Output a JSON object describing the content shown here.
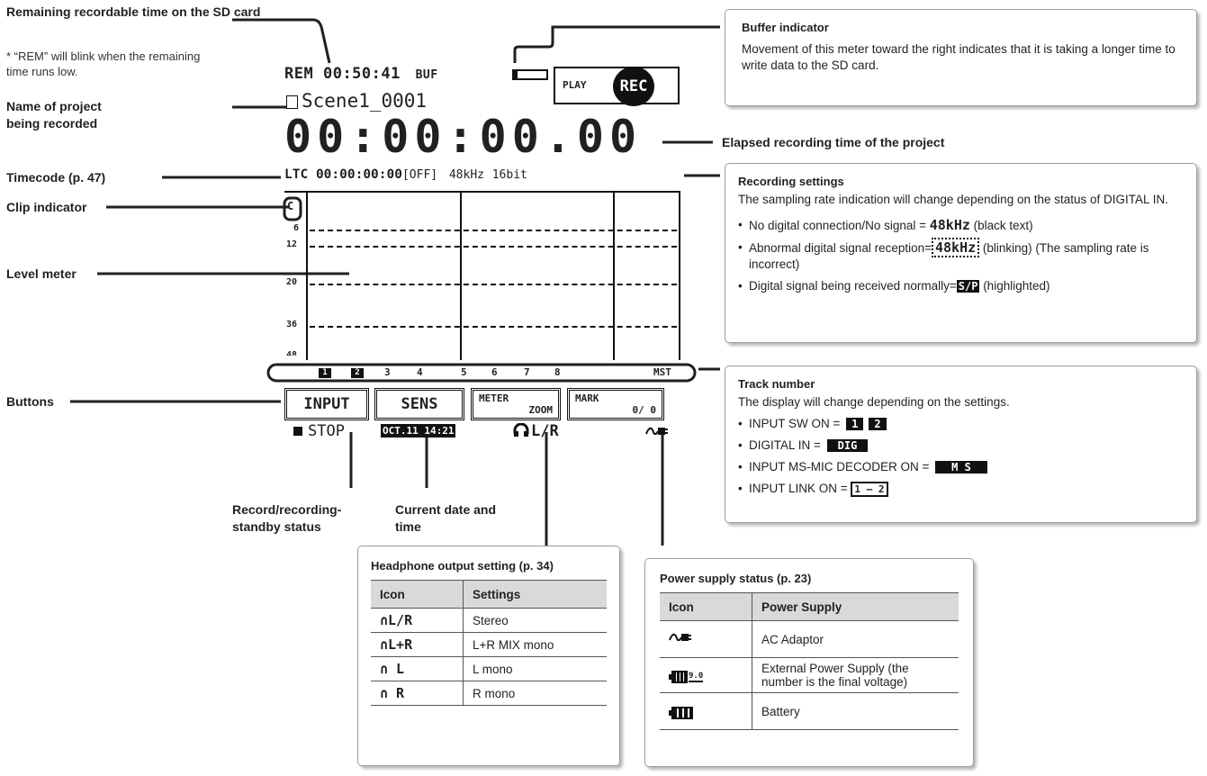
{
  "left_labels": {
    "remaining": "Remaining recordable time on the SD card",
    "remaining_note": "* “REM” will blink when the remaining time runs low.",
    "project_name": "Name of project being recorded",
    "timecode": "Timecode (p. 47)",
    "clip": "Clip indicator",
    "level_meter": "Level meter",
    "buttons": "Buttons"
  },
  "bottom_labels": {
    "record_status": "Record/recording-standby status",
    "date_time": "Current date and time"
  },
  "elapsed_label": "Elapsed recording time of the project",
  "screen": {
    "rem": "REM",
    "rem_time": "00:50:41",
    "buf": "BUF",
    "play": "PLAY",
    "rec": "REC",
    "project": "Scene1_0001",
    "elapsed": "00:00:00.00",
    "ltc": "LTC",
    "ltc_time": "00:00:00:00",
    "ltc_state": "[OFF]",
    "rate": "48kHz",
    "bits": "16bit",
    "clip": "C",
    "scale": [
      "6",
      "12",
      "20",
      "36",
      "48"
    ],
    "tracks": [
      "1",
      "2",
      "3",
      "4",
      "5",
      "6",
      "7",
      "8",
      "MST"
    ],
    "buttons": [
      "INPUT",
      "SENS",
      "METER",
      "ZOOM",
      "MARK",
      "0/ 0"
    ],
    "status": "STOP",
    "date": "OCT.11 14:21",
    "hp": "L/R"
  },
  "buffer_panel": {
    "title": "Buffer indicator",
    "text": "Movement of this meter toward the right indicates that it is taking a longer time to write data to the SD card."
  },
  "recording_panel": {
    "title": "Recording settings",
    "text": "The sampling rate indication will change depending on the status of DIGITAL IN.",
    "items": [
      {
        "pre": "No digital connection/No signal = ",
        "sample": "48kHz",
        "post": " (black text)"
      },
      {
        "pre": "Abnormal digital signal reception=",
        "sample": "48kHz",
        "post": " (blinking) (The sampling rate is incorrect)"
      },
      {
        "pre": "Digital signal being received normally=",
        "sample": "S/P",
        "post": " (highlighted)"
      }
    ]
  },
  "track_panel": {
    "title": "Track number",
    "text": "The display will change depending on the settings.",
    "items": [
      {
        "label": "INPUT SW ON = ",
        "chips": [
          "1",
          "2"
        ]
      },
      {
        "label": "DIGITAL IN = ",
        "chips": [
          "DIG"
        ]
      },
      {
        "label": "INPUT MS-MIC DECODER ON = ",
        "chips": [
          "M S"
        ]
      },
      {
        "label": "INPUT LINK ON = ",
        "chips_boxed": [
          "1 — 2"
        ]
      }
    ]
  },
  "headphone_panel": {
    "title": "Headphone output setting (p. 34)",
    "headers": [
      "Icon",
      "Settings"
    ],
    "rows": [
      {
        "icon": "L/R",
        "setting": "Stereo"
      },
      {
        "icon": "L+R",
        "setting": "L+R MIX mono"
      },
      {
        "icon": " L",
        "setting": "L mono"
      },
      {
        "icon": " R",
        "setting": "R mono"
      }
    ]
  },
  "power_panel": {
    "title": "Power supply status (p. 23)",
    "headers": [
      "Icon",
      "Power Supply"
    ],
    "rows": [
      {
        "icon": "ac-plug-icon",
        "setting": "AC Adaptor"
      },
      {
        "icon": "battery-voltage-icon",
        "icon_text": "9.0",
        "setting": "External Power Supply (the number is the final voltage)"
      },
      {
        "icon": "battery-icon",
        "setting": "Battery"
      }
    ]
  }
}
